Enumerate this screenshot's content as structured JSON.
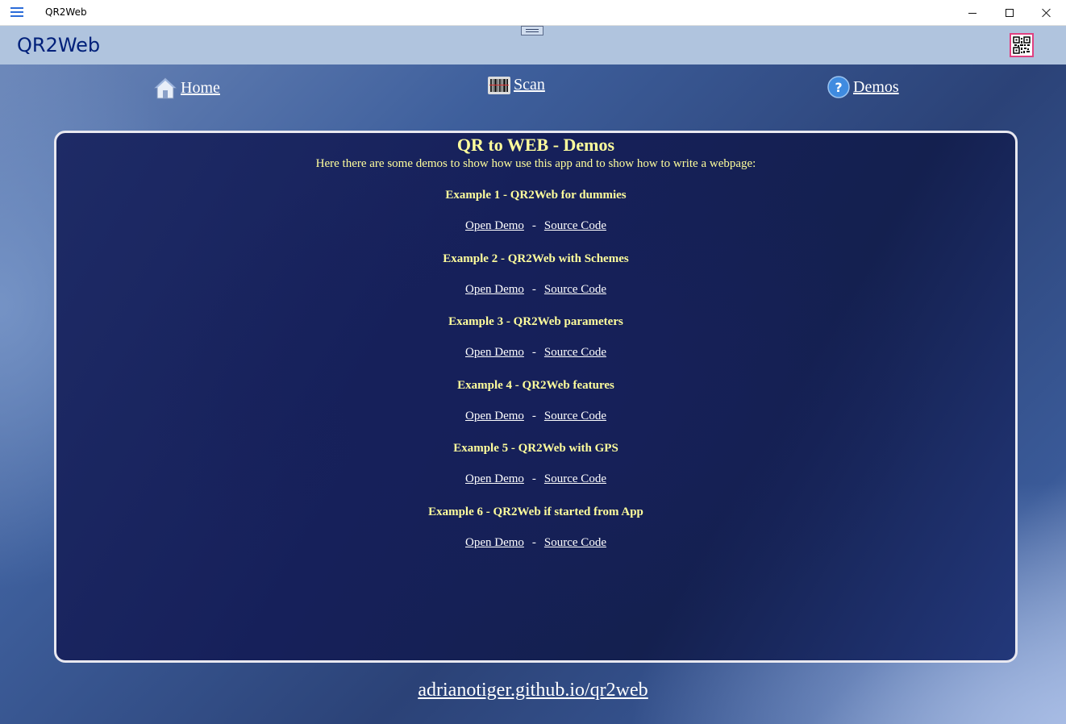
{
  "window": {
    "title": "QR2Web"
  },
  "header": {
    "brand": "QR2Web"
  },
  "nav": {
    "home": "Home",
    "scan": "Scan",
    "demos": "Demos"
  },
  "panel": {
    "title": "QR to WEB - Demos",
    "subtitle": "Here there are some demos to show how use this app and to show how to write a webpage:",
    "examples": [
      {
        "title": "Example 1 - QR2Web for dummies",
        "open": "Open Demo",
        "sep": "-",
        "source": "Source Code"
      },
      {
        "title": "Example 2 - QR2Web with Schemes",
        "open": "Open Demo",
        "sep": "-",
        "source": "Source Code"
      },
      {
        "title": "Example 3 - QR2Web parameters",
        "open": "Open Demo",
        "sep": "-",
        "source": "Source Code"
      },
      {
        "title": "Example 4 - QR2Web features",
        "open": "Open Demo",
        "sep": "-",
        "source": "Source Code"
      },
      {
        "title": "Example 5 - QR2Web with GPS",
        "open": "Open Demo",
        "sep": "-",
        "source": "Source Code"
      },
      {
        "title": "Example 6 - QR2Web if started from App",
        "open": "Open Demo",
        "sep": "-",
        "source": "Source Code"
      }
    ]
  },
  "footer": {
    "link": "adrianotiger.github.io/qr2web"
  },
  "colors": {
    "header_bg": "#b0c4de",
    "brand": "#00207a",
    "accent_yellow": "#fffe9c",
    "panel_bg": "#16205a"
  },
  "icons": [
    "hamburger-menu-icon",
    "minimize-icon",
    "maximize-icon",
    "close-icon",
    "qr-code-icon",
    "home-icon",
    "barcode-icon",
    "help-icon"
  ]
}
